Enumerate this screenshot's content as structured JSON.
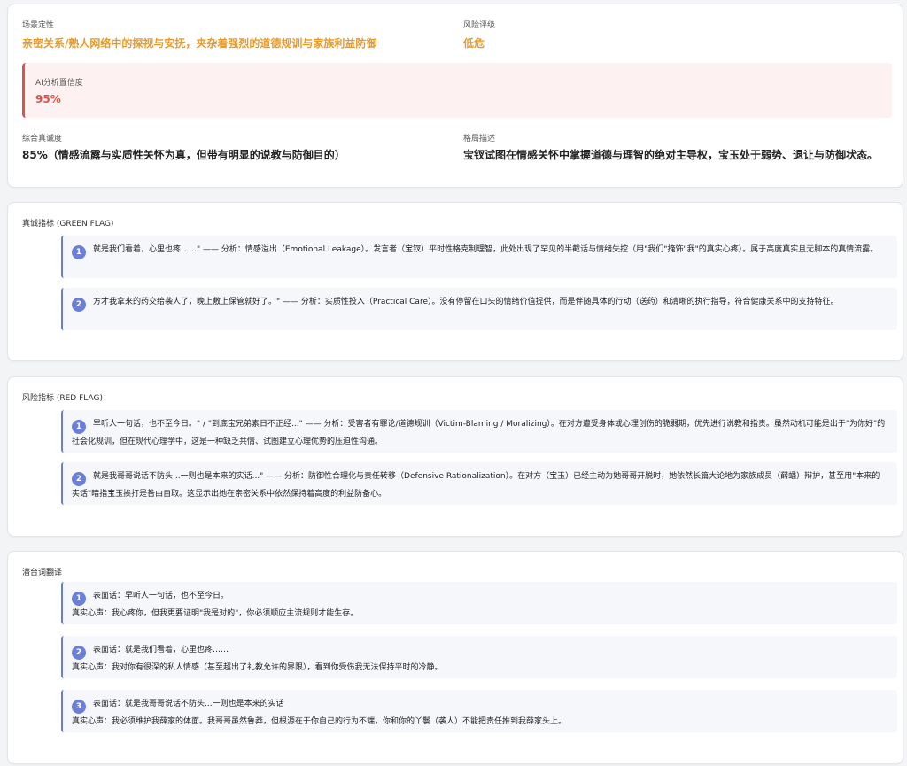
{
  "summary": {
    "scene_label": "场景定性",
    "scene_value": "亲密关系/熟人网络中的探视与安抚，夹杂着强烈的道德规训与家族利益防御",
    "risk_label": "风险评级",
    "risk_value": "低危",
    "confidence_label": "AI分析置信度",
    "confidence_value": "95%",
    "sincerity_label": "综合真诚度",
    "sincerity_value": "85%（情感流露与实质性关怀为真，但带有明显的说教与防御目的）",
    "pattern_label": "格局描述",
    "pattern_value": "宝钗试图在情感关怀中掌握道德与理智的绝对主导权，宝玉处于弱势、退让与防御状态。"
  },
  "green": {
    "title": "真诚指标 (GREEN FLAG)",
    "items": [
      {
        "num": "1",
        "text": "就是我们看着，心里也疼……\" —— 分析：情感溢出（Emotional Leakage）。发言者（宝钗）平时性格克制理智，此处出现了罕见的半截话与情绪失控（用\"我们\"掩饰\"我\"的真实心疼）。属于高度真实且无脚本的真情流露。"
      },
      {
        "num": "2",
        "text": "方才我拿来的药交给袭人了，晚上敷上保管就好了。\" —— 分析：实质性投入（Practical Care）。没有停留在口头的情绪价值提供，而是伴随具体的行动（送药）和清晰的执行指导，符合健康关系中的支持特征。"
      }
    ]
  },
  "red": {
    "title": "风险指标 (RED FLAG)",
    "items": [
      {
        "num": "1",
        "text": "早听人一句话，也不至今日。\" / \"到底宝兄弟素日不正经...\" —— 分析：受害者有罪论/道德规训（Victim-Blaming / Moralizing）。在对方遭受身体或心理创伤的脆弱期，优先进行说教和指责。虽然动机可能是出于\"为你好\"的社会化规训，但在现代心理学中，这是一种缺乏共情、试图建立心理优势的压迫性沟通。"
      },
      {
        "num": "2",
        "text": "就是我哥哥说话不防头...一则也是本来的实话...\" —— 分析：防御性合理化与责任转移（Defensive Rationalization）。在对方（宝玉）已经主动为她哥哥开脱时，她依然长篇大论地为家族成员（薛蟠）辩护，甚至用\"本来的实话\"暗指宝玉挨打是咎由自取。这显示出她在亲密关系中依然保持着高度的利益防备心。"
      }
    ]
  },
  "subtext": {
    "title": "潜台词翻译",
    "items": [
      {
        "num": "1",
        "surface": "表面话：早听人一句话，也不至今日。",
        "real": "真实心声：我心疼你，但我更要证明\"我是对的\"，你必须顺应主流规则才能生存。"
      },
      {
        "num": "2",
        "surface": "表面话：就是我们看着，心里也疼……",
        "real": "真实心声：我对你有很深的私人情感（甚至超出了礼教允许的界限），看到你受伤我无法保持平时的冷静。"
      },
      {
        "num": "3",
        "surface": "表面话：就是我哥哥说话不防头...一则也是本来的实话",
        "real": "真实心声：我必须维护我薛家的体面。我哥哥虽然鲁莽，但根源在于你自己的行为不端，你和你的丫鬟（袭人）不能把责任推到我薛家头上。"
      }
    ]
  }
}
